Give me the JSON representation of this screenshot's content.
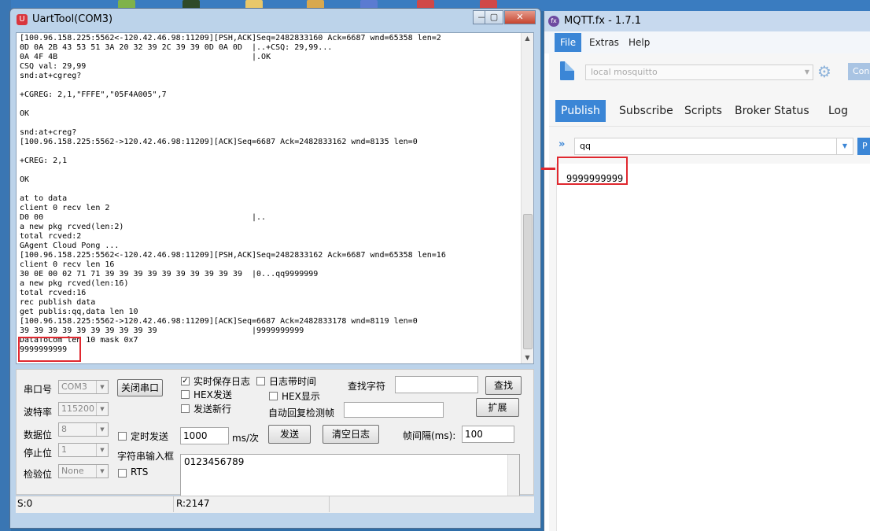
{
  "uart": {
    "title": "UartTool(COM3)",
    "window_buttons": {
      "minimize": "—",
      "maximize": "▢",
      "close": "✕"
    },
    "log_lines": [
      "[100.96.158.225:5562<-120.42.46.98:11209][PSH,ACK]Seq=2482833160 Ack=6687 wnd=65358 len=2",
      "0D 0A 2B 43 53 51 3A 20 32 39 2C 39 39 0D 0A 0D  |..+CSQ: 29,99...",
      "0A 4F 4B                                         |.OK",
      "CSQ val: 29,99",
      "snd:at+cgreg?",
      "",
      "+CGREG: 2,1,\"FFFE\",\"05F4A005\",7",
      "",
      "OK",
      "",
      "snd:at+creg?",
      "[100.96.158.225:5562->120.42.46.98:11209][ACK]Seq=6687 Ack=2482833162 wnd=8135 len=0",
      "",
      "+CREG: 2,1",
      "",
      "OK",
      "",
      "at to data",
      "client 0 recv len 2",
      "D0 00                                            |..",
      "a new pkg rcved(len:2)",
      "total rcved:2",
      "GAgent Cloud Pong ...",
      "[100.96.158.225:5562<-120.42.46.98:11209][PSH,ACK]Seq=2482833162 Ack=6687 wnd=65358 len=16",
      "client 0 recv len 16",
      "30 0E 00 02 71 71 39 39 39 39 39 39 39 39 39 39  |0...qq9999999",
      "a new pkg rcved(len:16)",
      "total rcved:16",
      "rec publish data",
      "get publis:qq,data len 10",
      "[100.96.158.225:5562->120.42.46.98:11209][ACK]Seq=6687 Ack=2482833178 wnd=8119 len=0",
      "39 39 39 39 39 39 39 39 39 39                    |9999999999",
      "DataToCom len 10 mask 0x7",
      "9999999999"
    ],
    "controls": {
      "port_label": "串口号",
      "port_value": "COM3",
      "baud_label": "波特率",
      "baud_value": "115200",
      "databits_label": "数据位",
      "databits_value": "8",
      "stopbits_label": "停止位",
      "stopbits_value": "1",
      "parity_label": "检验位",
      "parity_value": "None",
      "close_port_btn": "关闭串口",
      "save_log_label": "实时保存日志",
      "log_time_label": "日志带时间",
      "hex_send_label": "HEX发送",
      "hex_show_label": "HEX显示",
      "send_newline_label": "发送新行",
      "auto_reply_label": "自动回复检测帧",
      "find_label": "查找字符",
      "find_btn": "查找",
      "expand_btn": "扩展",
      "timed_send_label": "定时发送",
      "timed_send_value": "1000",
      "ms_label": "ms/次",
      "send_btn": "发送",
      "clear_log_btn": "清空日志",
      "frame_interval_label": "帧间隔(ms):",
      "frame_interval_value": "100",
      "string_input_label": "字符串输入框",
      "rts_label": "RTS",
      "string_input_value": "0123456789",
      "check_mark": "✓"
    },
    "status": {
      "sent": "S:0",
      "received": "R:2147"
    }
  },
  "mqtt": {
    "title": "MQTT.fx - 1.7.1",
    "menu": [
      "File",
      "Extras",
      "Help"
    ],
    "connection_profile": "local mosquitto",
    "connect_btn": "Con",
    "tabs": [
      "Publish",
      "Subscribe",
      "Scripts",
      "Broker Status",
      "Log"
    ],
    "topic": "qq",
    "publish_btn": "P",
    "payload": "9999999999"
  },
  "colors": {
    "highlight": "#e0282f",
    "accent": "#3b86d6"
  }
}
